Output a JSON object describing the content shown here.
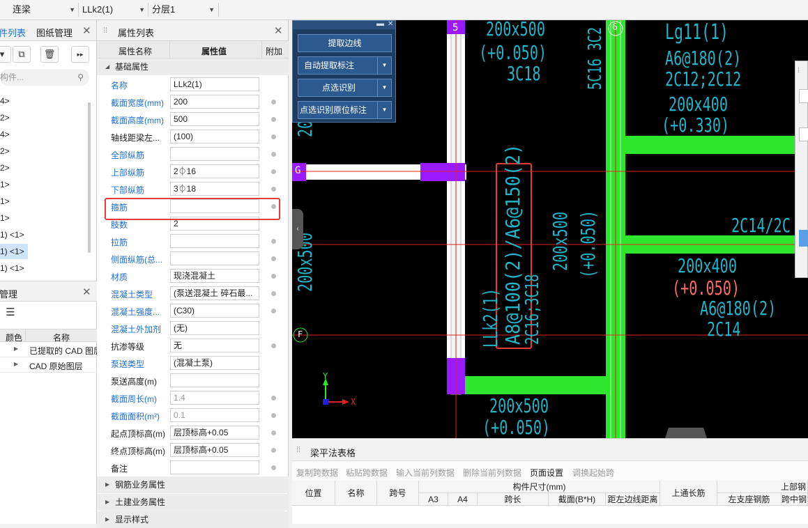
{
  "toolbar": {
    "dropdowns": [
      {
        "label": "连梁"
      },
      {
        "label": "LLk2(1)"
      },
      {
        "label": "分层1"
      }
    ]
  },
  "left_panel": {
    "tabs": [
      "件列表",
      "图纸管理"
    ],
    "search_placeholder": "构件...",
    "items": [
      "4>",
      "2>",
      "4>",
      "2>",
      "2>",
      "1>",
      "1>",
      "1>",
      "1) <1>",
      "1) <1>",
      "1) <1>"
    ],
    "selected_index": 9
  },
  "layer_panel": {
    "title": "管理",
    "columns": [
      "颜色",
      "名称"
    ],
    "rows": [
      "已提取的 CAD 图层",
      "CAD 原始图层"
    ]
  },
  "property_panel": {
    "title": "属性列表",
    "columns": [
      "属性名称",
      "属性值",
      "附加"
    ],
    "groups": {
      "basic": "基础属性",
      "rebar": "钢筋业务属性",
      "civil": "土建业务属性",
      "display": "显示样式"
    },
    "rows": [
      {
        "name": "名称",
        "value": "LLk2(1)",
        "blue": true,
        "dot": false
      },
      {
        "name": "截面宽度(mm)",
        "value": "200",
        "blue": true,
        "dot": true
      },
      {
        "name": "截面高度(mm)",
        "value": "500",
        "blue": true,
        "dot": true
      },
      {
        "name": "轴线距梁左...",
        "value": "(100)",
        "blue": false,
        "dot": true
      },
      {
        "name": "全部纵筋",
        "value": "",
        "blue": true,
        "dot": true
      },
      {
        "name": "上部纵筋",
        "value": "2⏀16",
        "blue": true,
        "dot": true
      },
      {
        "name": "下部纵筋",
        "value": "3⏀18",
        "blue": true,
        "dot": true
      },
      {
        "name": "箍筋",
        "value": "",
        "blue": true,
        "dot": true
      },
      {
        "name": "肢数",
        "value": "2",
        "blue": true,
        "dot": false
      },
      {
        "name": "拉筋",
        "value": "",
        "blue": true,
        "dot": true
      },
      {
        "name": "侧面纵筋(总...",
        "value": "",
        "blue": true,
        "dot": true
      },
      {
        "name": "材质",
        "value": "现浇混凝土",
        "blue": true,
        "dot": true
      },
      {
        "name": "混凝土类型",
        "value": "(泵送混凝土 碎石最...",
        "blue": true,
        "dot": true
      },
      {
        "name": "混凝土强度...",
        "value": "(C30)",
        "blue": true,
        "dot": true
      },
      {
        "name": "混凝土外加剂",
        "value": "(无)",
        "blue": true,
        "dot": false
      },
      {
        "name": "抗渗等级",
        "value": "无",
        "blue": false,
        "dot": true
      },
      {
        "name": "泵送类型",
        "value": "(混凝土泵)",
        "blue": true,
        "dot": false
      },
      {
        "name": "泵送高度(m)",
        "value": "",
        "blue": false,
        "dot": false
      },
      {
        "name": "截面周长(m)",
        "value": "1.4",
        "blue": true,
        "dot": true,
        "gray": true
      },
      {
        "name": "截面面积(m²)",
        "value": "0.1",
        "blue": true,
        "dot": true,
        "gray": true
      },
      {
        "name": "起点顶标高(m)",
        "value": "层顶标高+0.05",
        "blue": false,
        "dot": true
      },
      {
        "name": "终点顶标高(m)",
        "value": "层顶标高+0.05",
        "blue": false,
        "dot": true
      },
      {
        "name": "备注",
        "value": "",
        "blue": false,
        "dot": true
      }
    ]
  },
  "float_panel": {
    "buttons": [
      {
        "label": "提取边线",
        "split": false
      },
      {
        "label": "自动提取标注",
        "split": true
      },
      {
        "label": "点选识别",
        "split": true
      },
      {
        "label": "点选识别原位标注",
        "split": true
      }
    ]
  },
  "cad": {
    "axis_labels": [
      "5",
      "6",
      "G",
      "F"
    ],
    "texts": {
      "t1": "200x500",
      "t2": "(+0.050)",
      "t3": "3C18",
      "t4": "5C16 3C2",
      "t5": "Lg11(1)",
      "t6": "A6@180(2)",
      "t7": "2C12;2C12",
      "t8": "200x400",
      "t9": "(+0.330)",
      "t10": "2C14/2C",
      "t11": "200x400",
      "t12": "(+0.050)",
      "t13": "A6@180(2)",
      "t14": "2C14",
      "t15": "200x500",
      "t16": "(+0.050)",
      "t17": "LLk2(1)",
      "t18": "A8@100(2)/A6@150(2)",
      "t19": "2C16;3C18",
      "t20": "200x500",
      "t21": "(+0.050)",
      "t22": "200x500",
      "t23": "(+0.050)",
      "t24": "200x500",
      "t25": "20"
    },
    "ucs": {
      "x": "X",
      "y": "Y"
    }
  },
  "bottom_panel": {
    "title": "梁平法表格",
    "tools": [
      {
        "label": "复制跨数据",
        "active": false
      },
      {
        "label": "粘贴跨数据",
        "active": false
      },
      {
        "label": "输入当前列数据",
        "active": false
      },
      {
        "label": "删除当前列数据",
        "active": false
      },
      {
        "label": "页面设置",
        "active": true
      },
      {
        "label": "调换起始跨",
        "active": false
      }
    ],
    "headers": {
      "pos": "位置",
      "name": "名称",
      "span": "跨号",
      "dims": "构件尺寸(mm)",
      "a3": "A3",
      "a4": "A4",
      "spanlen": "跨长",
      "section": "截面(B*H)",
      "offset": "距左边线距离",
      "top_through": "上通长筋",
      "top_rebar": "上部钢",
      "left_support": "左支座钢筋",
      "mid": "跨中钢"
    }
  },
  "colors": {
    "cyan": "#22b4c8",
    "green": "#2ee62e",
    "purple": "#9a1aff",
    "red": "#e83a3a",
    "accent": "#1e6fd0"
  }
}
